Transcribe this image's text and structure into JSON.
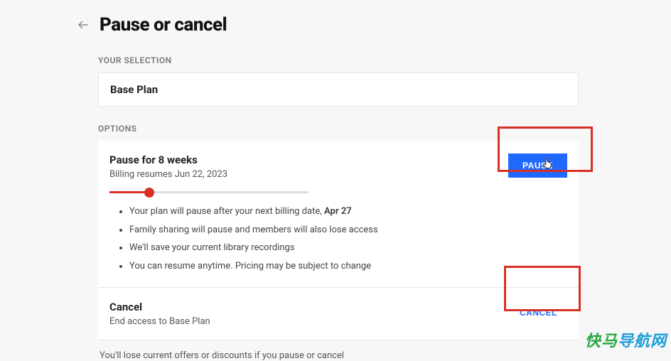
{
  "header": {
    "title": "Pause or cancel"
  },
  "sections": {
    "selection_label": "YOUR SELECTION",
    "options_label": "OPTIONS"
  },
  "selection": {
    "plan_name": "Base Plan"
  },
  "pause_option": {
    "title": "Pause for 8 weeks",
    "subtitle": "Billing resumes Jun 22, 2023",
    "button_label": "PAUSE",
    "bullets": {
      "b1_prefix": "Your plan will pause after your next billing date, ",
      "b1_date": "Apr 27",
      "b2": "Family sharing will pause and members will also lose access",
      "b3": "We'll save your current library recordings",
      "b4": "You can resume anytime. Pricing may be subject to change"
    },
    "slider": {
      "min_weeks": 1,
      "max_weeks": 48,
      "value_weeks": 8,
      "percent": 20
    }
  },
  "cancel_option": {
    "title": "Cancel",
    "subtitle": "End access to Base Plan",
    "button_label": "CANCEL"
  },
  "footer_note": "You'll lose current offers or discounts if you pause or cancel",
  "watermark": {
    "c1": "快",
    "c2": "马",
    "c3": "导",
    "c4": "航",
    "c5": "网"
  }
}
